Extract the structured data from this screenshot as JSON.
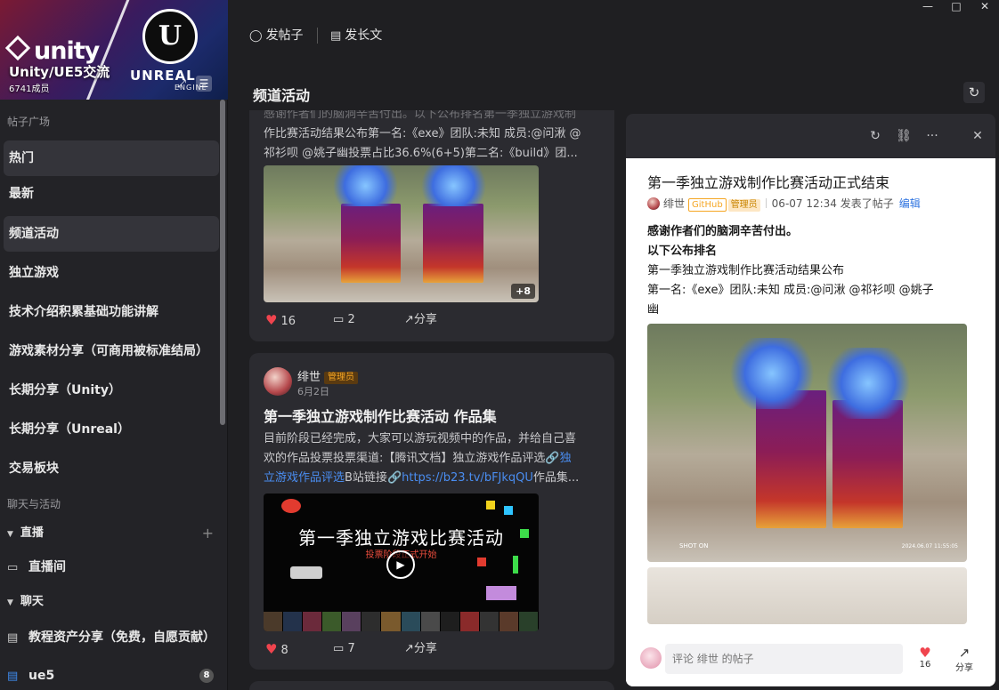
{
  "window": {
    "minimize": "—",
    "maximize": "□",
    "close": "✕"
  },
  "sidebar": {
    "group_title": "Unity/UE5交流",
    "members": "6741成员",
    "banner_unity": "unity",
    "banner_ue_mark": "U",
    "banner_unreal": "UNREAL",
    "banner_engine": "ENGINE",
    "section_posts": "帖子广场",
    "items": [
      {
        "label": "热门"
      },
      {
        "label": "最新"
      },
      {
        "label": "频道活动"
      },
      {
        "label": "独立游戏"
      },
      {
        "label": "技术介绍积累基础功能讲解"
      },
      {
        "label": "游戏素材分享（可商用被标准结局）"
      },
      {
        "label": "长期分享（Unity）"
      },
      {
        "label": "长期分享（Unreal）"
      },
      {
        "label": "交易板块"
      }
    ],
    "section_chat": "聊天与活动",
    "live_group": "直播",
    "live_room": "直播间",
    "chat_group": "聊天",
    "channel_tutorial": "教程资产分享（免费，自愿贡献）",
    "channel_ue5": "ue5",
    "ue5_badge": "8"
  },
  "toolbar": {
    "post": "发帖子",
    "long_post": "发长文"
  },
  "main": {
    "title": "频道活动"
  },
  "feed": [
    {
      "excerpt_top": "感谢作者们的脑洞辛苦付出。以下公布排名第一季独立游戏制",
      "excerpt_line2": "作比赛活动结果公布第一名:《exe》团队:未知 成员:@问湫 @",
      "excerpt_line3": "祁衫呗 @姚子幽投票占比36.6%(6+5)第二名:《build》团...",
      "more_images": "+8",
      "likes": "16",
      "comments": "2",
      "share": "分享"
    },
    {
      "author": "绯世",
      "role": "管理员",
      "date": "6月2日",
      "title": "第一季独立游戏制作比赛活动 作品集",
      "excerpt_line1": "目前阶段已经完成，大家可以游玩视频中的作品，并给自己喜",
      "excerpt_line2a": "欢的作品投票投票渠道:【腾讯文档】独立游戏作品评选",
      "excerpt_link1a": "🔗独",
      "excerpt_link1b": "立游戏作品评选",
      "excerpt_line3": "B站链接",
      "excerpt_link2": "🔗https://b23.tv/bFJkqQU",
      "excerpt_tail": "作品集...",
      "video_title": "第一季独立游戏比赛活动",
      "video_sub": "投票阶段正式开始",
      "likes": "8",
      "comments": "7",
      "share": "分享"
    }
  ],
  "detail": {
    "title": "第一季独立游戏制作比赛活动正式结束",
    "author": "绯世",
    "badge_github": "GitHub",
    "badge_admin": "管理员",
    "time": "06-07 12:34 发表了帖子",
    "edit": "编辑",
    "line1": "感谢作者们的脑洞辛苦付出。",
    "line2": "以下公布排名",
    "line3": "第一季独立游戏制作比赛活动结果公布",
    "line4": "第一名:《exe》团队:未知 成员:@问湫 @祁衫呗 @姚子",
    "line5": "幽",
    "image_stamp": "SHOT ON",
    "image_date": "2024.06.07 11:55:05",
    "comment_placeholder": "评论 绯世 的帖子",
    "likes": "16",
    "share": "分享"
  },
  "icons": {
    "heart": "♥",
    "comment": "▭",
    "share": "↗",
    "refresh": "↻",
    "link": "⛓",
    "more": "···",
    "close": "✕",
    "bubble": "◯",
    "doc": "▤",
    "play": "▶",
    "expand": "⤢",
    "menu": "☰",
    "caret": "▼",
    "plus": "+",
    "live": "▭",
    "chat": "▤"
  },
  "colors": {
    "accent_link": "#2f74e0",
    "heart": "#f0444e",
    "admin_badge": "#f5a623",
    "panel_bg": "#ffffff",
    "app_bg": "#1f1f22"
  }
}
